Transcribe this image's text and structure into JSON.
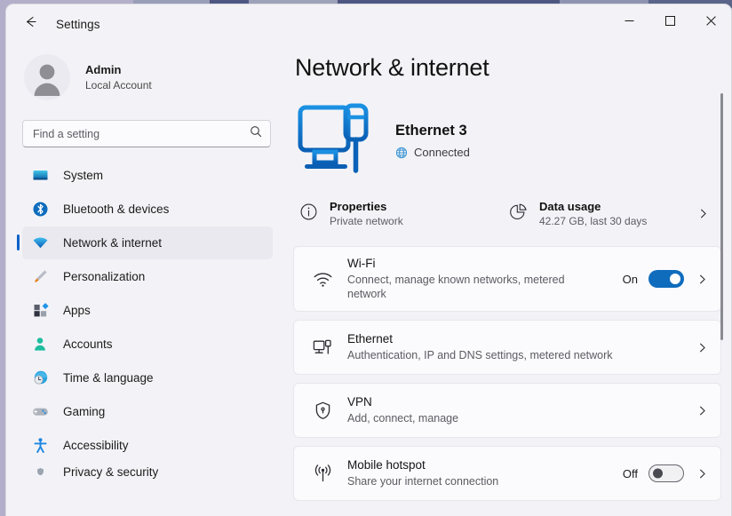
{
  "window": {
    "title": "Settings",
    "back_icon": "back-arrow-icon",
    "minimize_label": "Minimize",
    "maximize_label": "Maximize",
    "close_label": "Close"
  },
  "account": {
    "name": "Admin",
    "type": "Local Account",
    "avatar_icon": "user-avatar-icon"
  },
  "search": {
    "placeholder": "Find a setting",
    "value": "",
    "icon": "search-icon"
  },
  "sidebar": {
    "items": [
      {
        "label": "System",
        "icon": "system-monitor-icon",
        "selected": false
      },
      {
        "label": "Bluetooth & devices",
        "icon": "bluetooth-icon",
        "selected": false
      },
      {
        "label": "Network & internet",
        "icon": "wifi-icon",
        "selected": true
      },
      {
        "label": "Personalization",
        "icon": "paintbrush-icon",
        "selected": false
      },
      {
        "label": "Apps",
        "icon": "apps-grid-icon",
        "selected": false
      },
      {
        "label": "Accounts",
        "icon": "person-icon",
        "selected": false
      },
      {
        "label": "Time & language",
        "icon": "clock-globe-icon",
        "selected": false
      },
      {
        "label": "Gaming",
        "icon": "gamepad-icon",
        "selected": false
      },
      {
        "label": "Accessibility",
        "icon": "accessibility-person-icon",
        "selected": false
      },
      {
        "label": "Privacy & security",
        "icon": "shield-icon",
        "selected": false
      }
    ]
  },
  "page": {
    "title": "Network & internet"
  },
  "hero": {
    "illustration_icon": "ethernet-monitor-icon",
    "connection_name": "Ethernet 3",
    "status": "Connected",
    "status_icon": "globe-icon"
  },
  "quick_actions": [
    {
      "title": "Properties",
      "subtitle": "Private network",
      "icon": "info-circle-icon",
      "has_chevron": false
    },
    {
      "title": "Data usage",
      "subtitle": "42.27 GB, last 30 days",
      "icon": "pie-chart-icon",
      "has_chevron": true
    }
  ],
  "settings_cards": [
    {
      "title": "Wi-Fi",
      "subtitle": "Connect, manage known networks, metered network",
      "icon": "wifi-icon",
      "toggle": {
        "state_label": "On",
        "on": true
      },
      "has_chevron": true
    },
    {
      "title": "Ethernet",
      "subtitle": "Authentication, IP and DNS settings, metered network",
      "icon": "ethernet-icon",
      "toggle": null,
      "has_chevron": true
    },
    {
      "title": "VPN",
      "subtitle": "Add, connect, manage",
      "icon": "vpn-shield-icon",
      "toggle": null,
      "has_chevron": true
    },
    {
      "title": "Mobile hotspot",
      "subtitle": "Share your internet connection",
      "icon": "hotspot-antenna-icon",
      "toggle": {
        "state_label": "Off",
        "on": false
      },
      "has_chevron": true
    }
  ],
  "colors": {
    "accent": "#0d62c9",
    "toggle_on": "#0f6cbd",
    "window_bg": "#f3f3f7",
    "card_bg": "#fbfbfd",
    "desktop": "#b3aec9"
  },
  "scrollbar": {
    "visible": true
  }
}
